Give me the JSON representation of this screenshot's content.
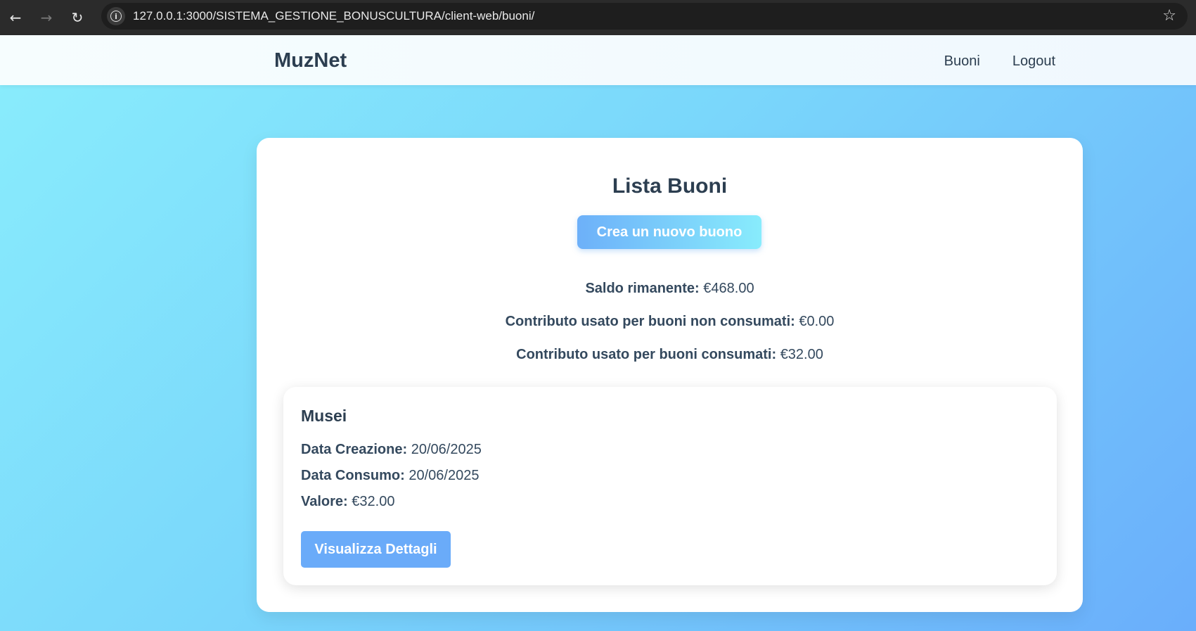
{
  "browser": {
    "url": "127.0.0.1:3000/SISTEMA_GESTIONE_BONUSCULTURA/client-web/buoni/",
    "back_icon": "←",
    "forward_icon": "→",
    "reload_icon": "↻",
    "info_icon": "i",
    "star_icon": "☆"
  },
  "nav": {
    "brand": "MuzNet",
    "links": [
      {
        "label": "Buoni"
      },
      {
        "label": "Logout"
      }
    ]
  },
  "main": {
    "title": "Lista Buoni",
    "create_button": "Crea un nuovo buono",
    "stats": [
      {
        "label": "Saldo rimanente:",
        "value": "€468.00"
      },
      {
        "label": "Contributo usato per buoni non consumati:",
        "value": "€0.00"
      },
      {
        "label": "Contributo usato per buoni consumati:",
        "value": "€32.00"
      }
    ]
  },
  "vouchers": [
    {
      "title": "Musei",
      "creation_label": "Data Creazione:",
      "creation_value": "20/06/2025",
      "consumption_label": "Data Consumo:",
      "consumption_value": "20/06/2025",
      "value_label": "Valore:",
      "value_value": "€32.00",
      "details_button": "Visualizza Dettagli"
    }
  ]
}
